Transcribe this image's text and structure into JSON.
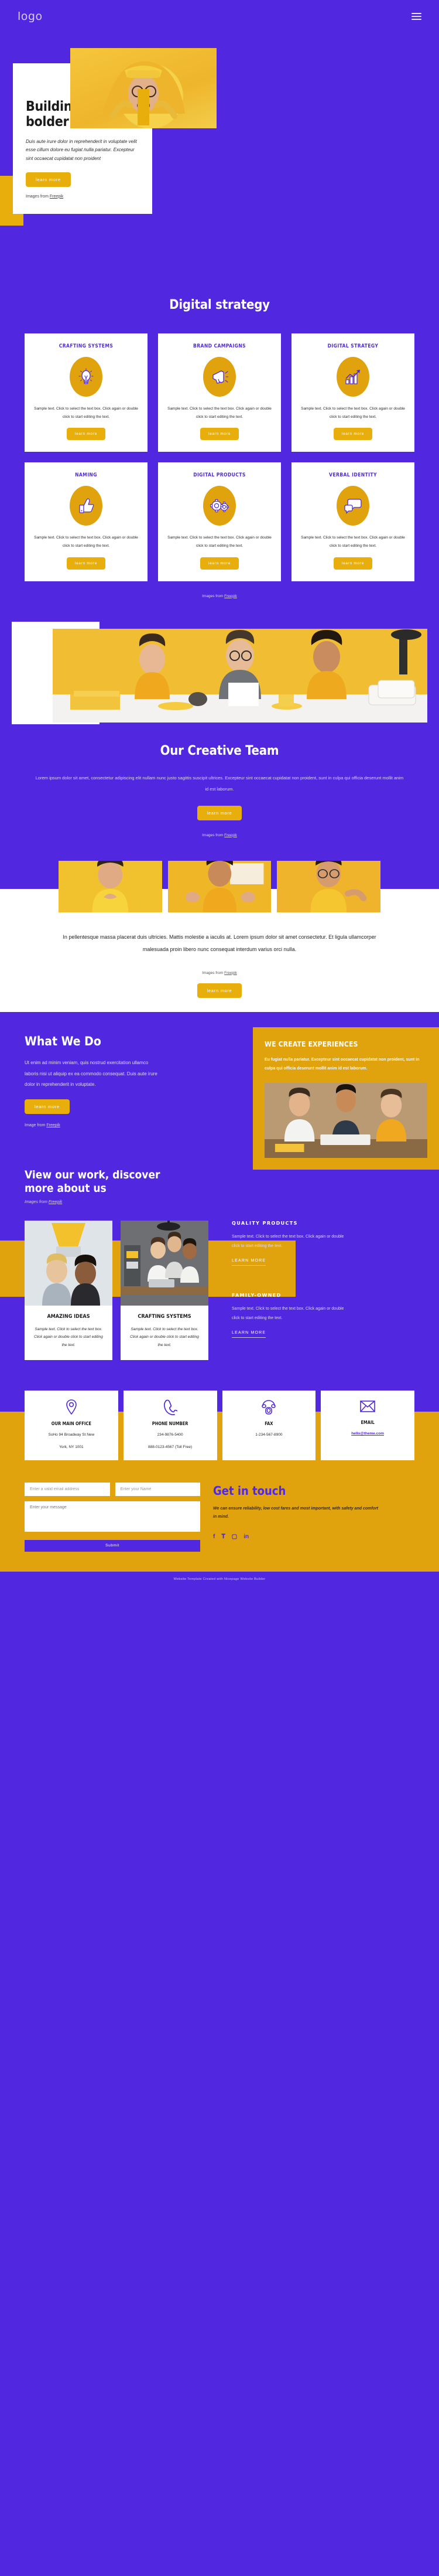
{
  "header": {
    "logo": "logo",
    "menu_icon": "hamburger-icon"
  },
  "hero": {
    "title_line1": "Building a",
    "title_line2": "bolder vision",
    "paragraph": "Duis aute irure dolor in reprehenderit in voluptate velit esse cillum dolore eu fugiat nulla pariatur. Excepteur sint occaecat cupidatat non proident",
    "cta": "learn more",
    "credit_prefix": "Images from ",
    "credit_link": "Freepik"
  },
  "strategy": {
    "title": "Digital strategy",
    "body": "Sample text. Click to select the text box. Click again or double click to start editing the text.",
    "cta": "learn more",
    "credit_prefix": "Images from ",
    "credit_link": "Freepik",
    "cards": [
      {
        "title": "CRAFTING SYSTEMS",
        "icon": "lightbulb-icon"
      },
      {
        "title": "BRAND CAMPAIGNS",
        "icon": "megaphone-icon"
      },
      {
        "title": "DIGITAL STRATEGY",
        "icon": "bar-chart-growth-icon"
      },
      {
        "title": "NAMING",
        "icon": "thumbs-up-icon"
      },
      {
        "title": "DIGITAL PRODUCTS",
        "icon": "gears-icon"
      },
      {
        "title": "VERBAL IDENTITY",
        "icon": "speech-bubbles-icon"
      }
    ]
  },
  "creative": {
    "title": "Our Creative Team",
    "paragraph": "Lorem ipsum dolor sit amet, consectetur adipiscing elit nullam nunc justo sagittis suscipit ultrices. Excepteur sint occaecat cupidatat non proident, sunt in culpa qui officia deserunt mollit anim id est laborum.",
    "cta": "learn more",
    "credit_prefix": "Images from ",
    "credit_link": "Freepik"
  },
  "quote": {
    "paragraph": "In pellentesque massa placerat duis ultricies. Mattis molestie a iaculis at. Lorem ipsum dolor sit amet consectetur. Et ligula ullamcorper malesuada proin libero nunc consequat interdum varius orci nulla.",
    "credit_prefix": "Images from ",
    "credit_link": "Freepik",
    "cta": "learn more"
  },
  "what_we_do": {
    "title": "What We Do",
    "paragraph": "Ut enim ad minim veniam, quis nostrud exercitation ullamco laboris nisi ut aliquip ex ea commodo consequat. Duis aute irure dolor in reprehenderit in voluptate.",
    "cta": "learn more",
    "credit_prefix": "Image from ",
    "credit_link": "Freepik",
    "panel_title": "WE CREATE EXPERIENCES",
    "panel_paragraph": "Eu fugiat nulla pariatur. Excepteur sint occaecat cupidatat non proident, sunt in culpa qui officia deserunt mollit anim id est laborum."
  },
  "view_work": {
    "title_line1": "View our work, discover",
    "title_line2": "more about us",
    "credit_prefix": "Images from ",
    "credit_link": "Freepik",
    "cards": [
      {
        "title": "AMAZING IDEAS",
        "body": "Sample text. Click to select the text box. Click again or double click to start editing the text."
      },
      {
        "title": "CRAFTING SYSTEMS",
        "body": "Sample text. Click to select the text box. Click again or double click to start editing the text."
      }
    ],
    "side": [
      {
        "title": "QUALITY PRODUCTS",
        "body": "Sample text. Click to select the text box. Click again or double click to start editing the text.",
        "link": "LEARN MORE"
      },
      {
        "title": "FAMILY-OWNED",
        "body": "Sample text. Click to select the text box. Click again or double click to start editing the text.",
        "link": "LEARN MORE"
      }
    ]
  },
  "contact": {
    "cards": [
      {
        "icon": "map-pin-icon",
        "title": "OUR MAIN OFFICE",
        "line1": "SoHo 94 Broadway St New",
        "line2": "York, NY 1001"
      },
      {
        "icon": "phone-icon",
        "title": "PHONE NUMBER",
        "line1": "234-9876-5400",
        "line2": "888-0123-4567 (Toll Free)"
      },
      {
        "icon": "fax-icon",
        "title": "FAX",
        "line1": "1-234-567-8900",
        "line2": ""
      },
      {
        "icon": "envelope-icon",
        "title": "EMAIL",
        "email": "hello@theme.com"
      }
    ],
    "form": {
      "email_placeholder": "Enter a valid email address",
      "name_placeholder": "Enter your Name",
      "message_placeholder": "Enter your message",
      "submit": "Submit"
    },
    "git_title": "Get in touch",
    "git_paragraph": "We can ensure reliability, low cost fares and most important, with safety and comfort in mind.",
    "socials": [
      "facebook-icon",
      "twitter-icon",
      "instagram-icon",
      "linkedin-icon"
    ]
  },
  "footer": {
    "text": "Website Template Created with Nicepage Website Builder"
  },
  "colors": {
    "purple": "#5128e0",
    "yellow": "#e0a30e",
    "white": "#ffffff"
  }
}
